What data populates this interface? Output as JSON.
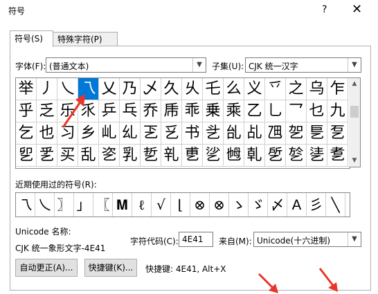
{
  "window": {
    "title": "符号",
    "help": "?",
    "close": "✕"
  },
  "tabs": [
    {
      "label": "符号(S)"
    },
    {
      "label": "特殊字符(P)"
    }
  ],
  "font": {
    "label": "字体(F):",
    "value": "(普通文本)"
  },
  "subset": {
    "label": "子集(U):",
    "value": "CJK 统一汉字"
  },
  "grid": {
    "rows": [
      [
        "举",
        "丿",
        "乀",
        "乁",
        "乂",
        "乃",
        "乄",
        "久",
        "乆",
        "乇",
        "么",
        "义",
        "乊",
        "之",
        "乌",
        "乍"
      ],
      [
        "乎",
        "乏",
        "乐",
        "乑",
        "乒",
        "乓",
        "乔",
        "乕",
        "乖",
        "乗",
        "乘",
        "乙",
        "乚",
        "乛",
        "乜",
        "九"
      ],
      [
        "乞",
        "也",
        "习",
        "乡",
        "乢",
        "乣",
        "乤",
        "乥",
        "书",
        "乧",
        "乨",
        "乩",
        "乪",
        "乫",
        "乬",
        "乭"
      ],
      [
        "乮",
        "乯",
        "买",
        "乱",
        "乲",
        "乳",
        "乴",
        "乵",
        "乶",
        "乷",
        "乸",
        "乹",
        "乺",
        "乻",
        "乼",
        "乽"
      ]
    ],
    "selected_index": 3
  },
  "recent": {
    "label": "近期使用过的符号(R):",
    "items": [
      "乁",
      "乀",
      "〗",
      "」",
      "〖",
      "𝐌",
      "ℓ",
      "√",
      "⌊",
      "⊗",
      "⊗",
      "ゝ",
      "ゞ",
      "〆",
      "𝖠",
      "彡",
      "╲"
    ]
  },
  "unicode_name": {
    "label": "Unicode 名称:",
    "value": "CJK 统一象形文字-4E41"
  },
  "char_code": {
    "label": "字符代码(C):",
    "value": "4E41"
  },
  "from": {
    "label": "来自(M):",
    "value": "Unicode(十六进制)"
  },
  "buttons": {
    "autocorrect": "自动更正(A)...",
    "shortcut": "快捷键(K)...",
    "shortcut_text": "快捷键: 4E41, Alt+X"
  },
  "colors": {
    "selection": "#0078d7",
    "arrow": "#e8362a"
  }
}
